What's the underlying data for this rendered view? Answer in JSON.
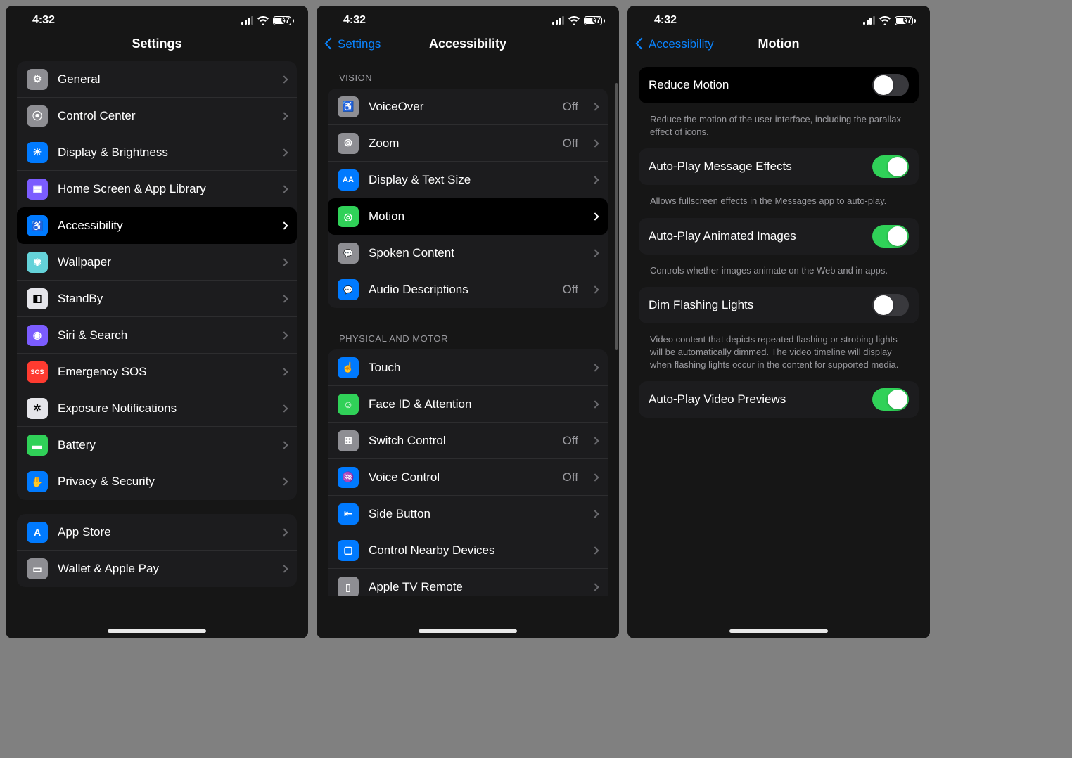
{
  "status": {
    "time": "4:32",
    "battery": "67"
  },
  "p1": {
    "title": "Settings",
    "groups": [
      {
        "items": [
          {
            "name": "general",
            "label": "General",
            "icon": "ic-gray",
            "glyph": "⚙"
          },
          {
            "name": "control-center",
            "label": "Control Center",
            "icon": "ic-gray",
            "glyph": "⦿"
          },
          {
            "name": "display-brightness",
            "label": "Display & Brightness",
            "icon": "ic-blue",
            "glyph": "☀"
          },
          {
            "name": "home-screen",
            "label": "Home Screen & App Library",
            "icon": "ic-purple",
            "glyph": "▦"
          },
          {
            "name": "accessibility",
            "label": "Accessibility",
            "icon": "ic-blue",
            "glyph": "♿",
            "highlight": true
          },
          {
            "name": "wallpaper",
            "label": "Wallpaper",
            "icon": "ic-teal",
            "glyph": "✾"
          },
          {
            "name": "standby",
            "label": "StandBy",
            "icon": "ic-white",
            "glyph": "◧"
          },
          {
            "name": "siri-search",
            "label": "Siri & Search",
            "icon": "ic-purple",
            "glyph": "◉"
          },
          {
            "name": "emergency-sos",
            "label": "Emergency SOS",
            "icon": "ic-red",
            "glyph": "SOS"
          },
          {
            "name": "exposure",
            "label": "Exposure Notifications",
            "icon": "ic-white",
            "glyph": "✲"
          },
          {
            "name": "battery",
            "label": "Battery",
            "icon": "ic-green",
            "glyph": "▬"
          },
          {
            "name": "privacy",
            "label": "Privacy & Security",
            "icon": "ic-blue",
            "glyph": "✋"
          }
        ]
      },
      {
        "items": [
          {
            "name": "app-store",
            "label": "App Store",
            "icon": "ic-blue",
            "glyph": "A"
          },
          {
            "name": "wallet",
            "label": "Wallet & Apple Pay",
            "icon": "ic-gray",
            "glyph": "▭"
          }
        ]
      }
    ]
  },
  "p2": {
    "back": "Settings",
    "title": "Accessibility",
    "sections": [
      {
        "header": "VISION",
        "items": [
          {
            "name": "voiceover",
            "label": "VoiceOver",
            "value": "Off",
            "icon": "ic-gray",
            "glyph": "♿"
          },
          {
            "name": "zoom",
            "label": "Zoom",
            "value": "Off",
            "icon": "ic-gray",
            "glyph": "⦾"
          },
          {
            "name": "display-text",
            "label": "Display & Text Size",
            "icon": "ic-blue",
            "glyph": "AA"
          },
          {
            "name": "motion",
            "label": "Motion",
            "icon": "ic-green",
            "glyph": "◎",
            "highlight": true
          },
          {
            "name": "spoken-content",
            "label": "Spoken Content",
            "icon": "ic-gray",
            "glyph": "💬"
          },
          {
            "name": "audio-descriptions",
            "label": "Audio Descriptions",
            "value": "Off",
            "icon": "ic-blue",
            "glyph": "💬"
          }
        ]
      },
      {
        "header": "PHYSICAL AND MOTOR",
        "items": [
          {
            "name": "touch",
            "label": "Touch",
            "icon": "ic-blue",
            "glyph": "☝"
          },
          {
            "name": "faceid",
            "label": "Face ID & Attention",
            "icon": "ic-green",
            "glyph": "☺"
          },
          {
            "name": "switch-control",
            "label": "Switch Control",
            "value": "Off",
            "icon": "ic-gray",
            "glyph": "⊞"
          },
          {
            "name": "voice-control",
            "label": "Voice Control",
            "value": "Off",
            "icon": "ic-blue",
            "glyph": "♒"
          },
          {
            "name": "side-button",
            "label": "Side Button",
            "icon": "ic-blue",
            "glyph": "⇤"
          },
          {
            "name": "nearby-devices",
            "label": "Control Nearby Devices",
            "icon": "ic-blue",
            "glyph": "▢"
          },
          {
            "name": "apple-tv",
            "label": "Apple TV Remote",
            "icon": "ic-gray",
            "glyph": "▯"
          }
        ]
      }
    ]
  },
  "p3": {
    "back": "Accessibility",
    "title": "Motion",
    "rows": [
      {
        "name": "reduce-motion",
        "label": "Reduce Motion",
        "toggle": false,
        "highlight": true,
        "footer": "Reduce the motion of the user interface, including the parallax effect of icons."
      },
      {
        "name": "autoplay-message",
        "label": "Auto-Play Message Effects",
        "toggle": true,
        "footer": "Allows fullscreen effects in the Messages app to auto-play."
      },
      {
        "name": "autoplay-animated",
        "label": "Auto-Play Animated Images",
        "toggle": true,
        "footer": "Controls whether images animate on the Web and in apps."
      },
      {
        "name": "dim-flashing",
        "label": "Dim Flashing Lights",
        "toggle": false,
        "footer": "Video content that depicts repeated flashing or strobing lights will be automatically dimmed. The video timeline will display when flashing lights occur in the content for supported media."
      },
      {
        "name": "autoplay-video",
        "label": "Auto-Play Video Previews",
        "toggle": true
      }
    ]
  }
}
